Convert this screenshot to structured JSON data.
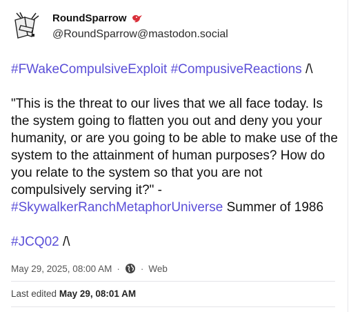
{
  "author": {
    "display_name": "RoundSparrow",
    "handle": "@RoundSparrow@mastodon.social",
    "avatar_icon": "sparrow-logo-avatar",
    "badge_icon": "red-bird-icon"
  },
  "post": {
    "line1_tag1": "#FWakeCompulsiveExploit",
    "line1_tag2": "#CompusiveReactions",
    "line1_suffix": "/\\",
    "quote": "\"This is the threat to our lives that we all face today. Is the system going to flatten you out and deny you your humanity, or are you going to be able to make use of the system to the attainment of human purposes? How do you relate to the system so that you are not compulsively serving it?\" -",
    "quote_tag": "#SkywalkerRanchMetaphorUniverse",
    "quote_suffix": "Summer of 1986",
    "footer_tag": "#JCQ02",
    "footer_suffix": "/\\"
  },
  "meta": {
    "timestamp": "May 29, 2025, 08:00 AM",
    "visibility_icon": "globe-icon",
    "application": "Web",
    "edited_label": "Last edited",
    "edited_time": "May 29, 08:01 AM"
  },
  "colors": {
    "hashtag": "#5b4fd8",
    "bird": "#d9303a"
  }
}
